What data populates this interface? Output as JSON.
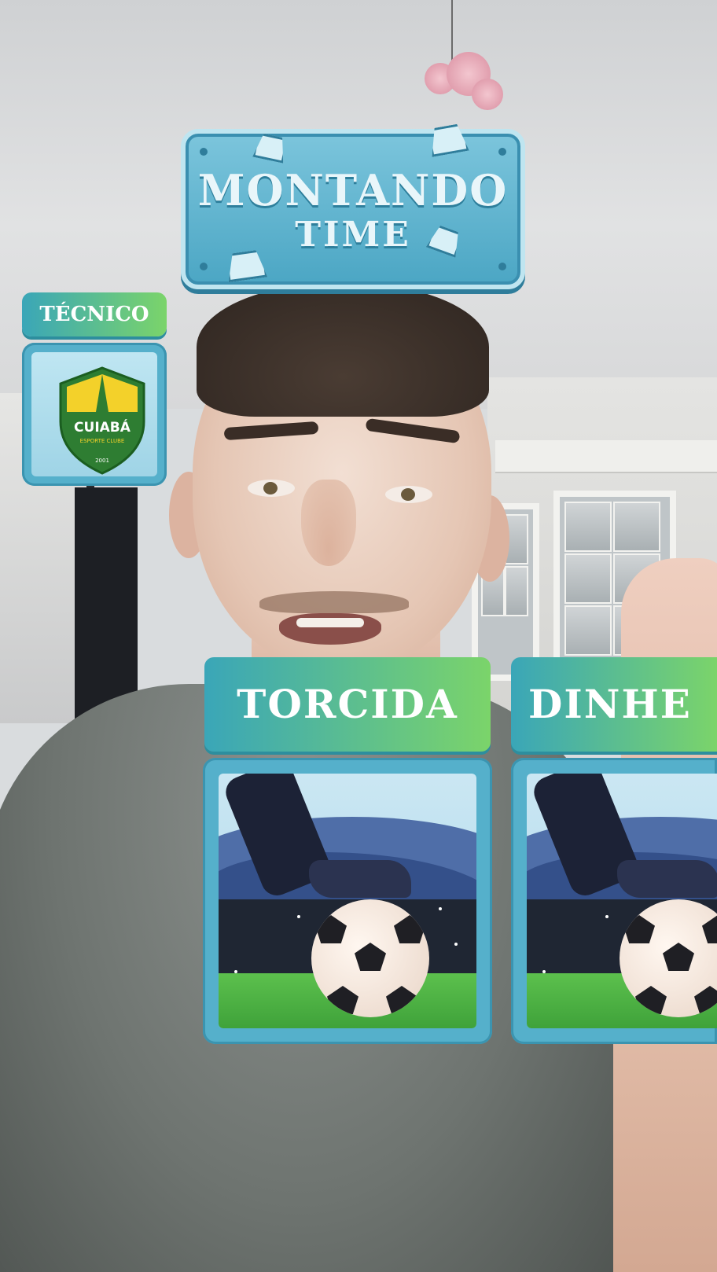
{
  "overlay": {
    "title_line1": "MONTANDO",
    "title_line2": "TIME",
    "coach_label": "TÉCNICO",
    "coach_team": {
      "name": "CUIABÁ",
      "subtitle": "ESPORTE CLUBE",
      "year": "2001",
      "crest_colors": {
        "primary": "#2e7d32",
        "accent": "#f3d12a"
      }
    },
    "categories": [
      {
        "label": "TORCIDA",
        "image": "soccer-ball-stadium"
      },
      {
        "label": "DINHE",
        "image": "soccer-ball-stadium"
      }
    ]
  },
  "colors": {
    "sign_blue": "#4ba6c4",
    "tab_gradient_start": "#3aa6b8",
    "tab_gradient_end": "#7bd46a",
    "card_frame": "#55b0cb"
  }
}
